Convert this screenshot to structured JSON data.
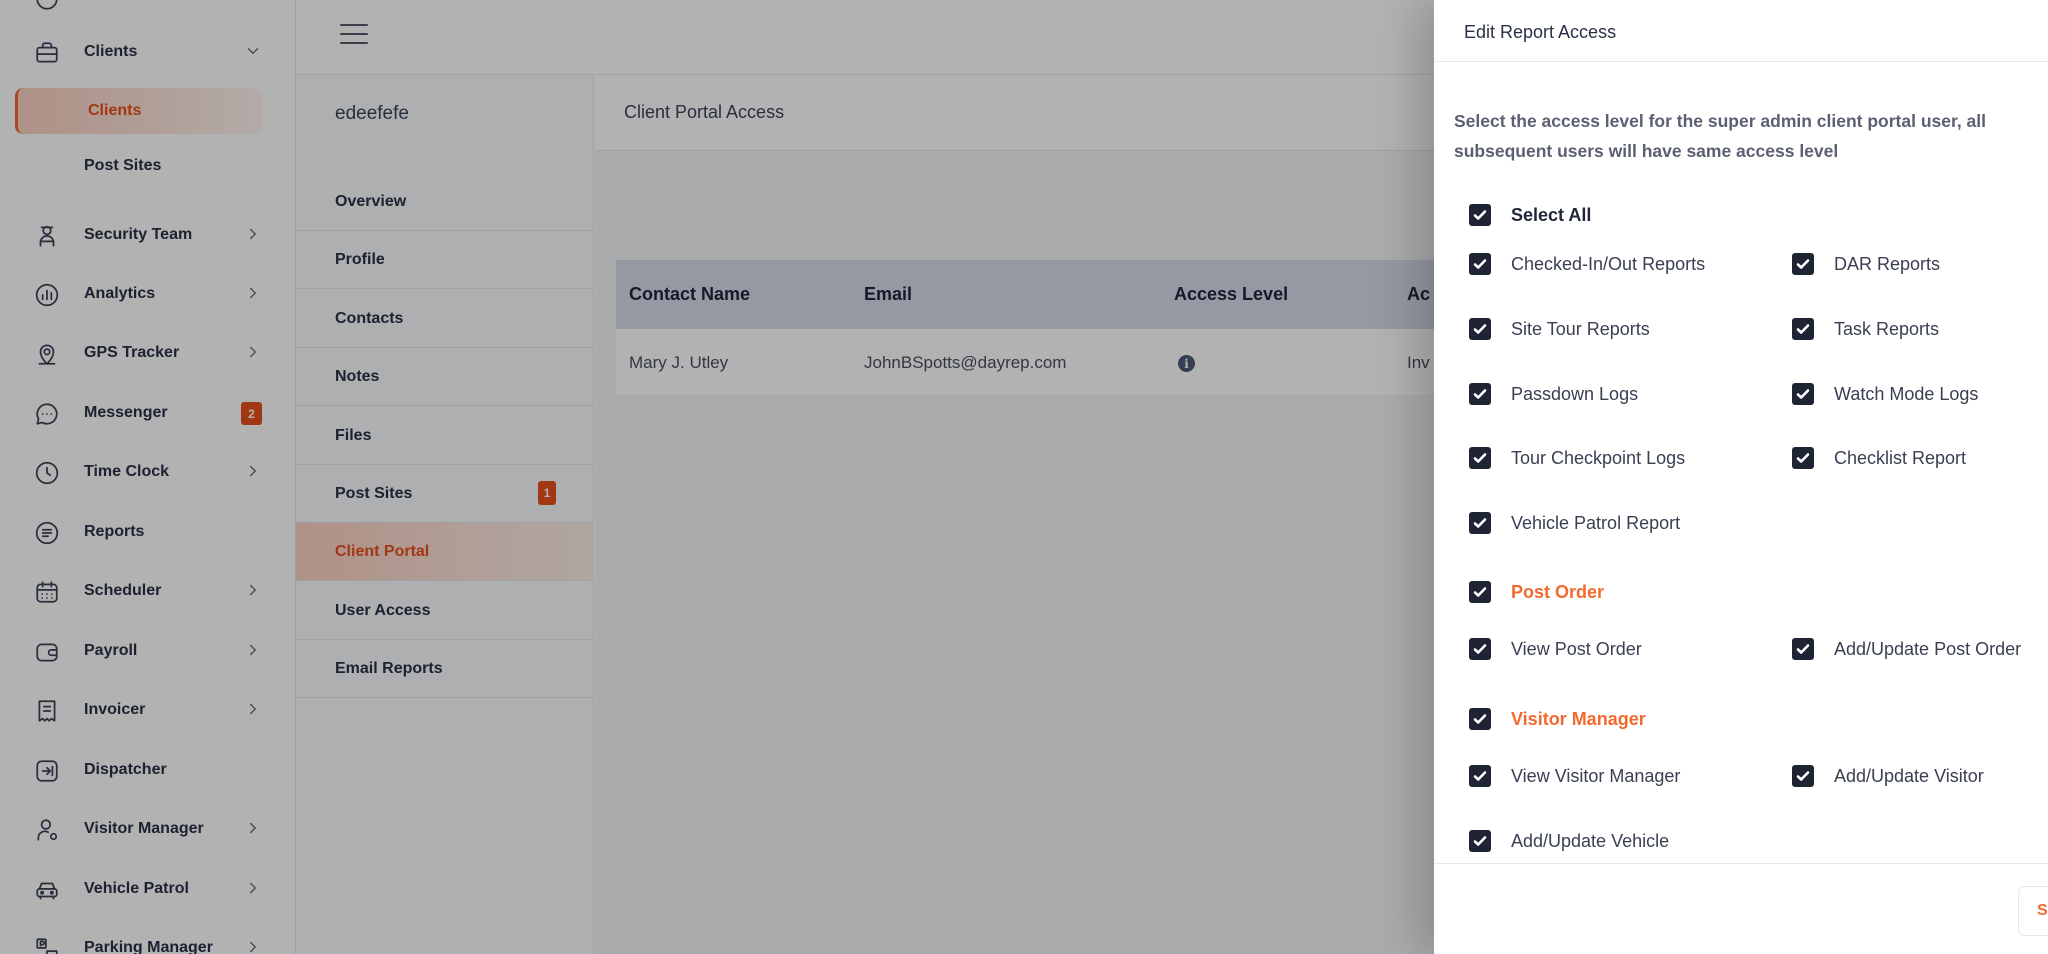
{
  "sidebar": {
    "items": [
      {
        "label": "Clients",
        "icon": "briefcase-icon",
        "chevron": "down"
      },
      {
        "label": "Security Team",
        "icon": "guard-icon",
        "chevron": "right"
      },
      {
        "label": "Analytics",
        "icon": "analytics-icon",
        "chevron": "right"
      },
      {
        "label": "GPS Tracker",
        "icon": "location-pin-icon",
        "chevron": "right"
      },
      {
        "label": "Messenger",
        "icon": "chat-icon",
        "badge": "2"
      },
      {
        "label": "Time Clock",
        "icon": "clock-icon",
        "chevron": "right"
      },
      {
        "label": "Reports",
        "icon": "report-icon"
      },
      {
        "label": "Scheduler",
        "icon": "calendar-icon",
        "chevron": "right"
      },
      {
        "label": "Payroll",
        "icon": "wallet-icon",
        "chevron": "right"
      },
      {
        "label": "Invoicer",
        "icon": "invoice-icon",
        "chevron": "right"
      },
      {
        "label": "Dispatcher",
        "icon": "dispatch-icon"
      },
      {
        "label": "Visitor Manager",
        "icon": "visitor-icon",
        "chevron": "right"
      },
      {
        "label": "Vehicle Patrol",
        "icon": "car-icon",
        "chevron": "right"
      },
      {
        "label": "Parking Manager",
        "icon": "parking-icon",
        "chevron": "right"
      }
    ],
    "sub_items": {
      "clients_active": "Clients",
      "post_sites": "Post Sites"
    }
  },
  "subnav": {
    "client_name": "edeefefe",
    "items": [
      {
        "label": "Overview"
      },
      {
        "label": "Profile"
      },
      {
        "label": "Contacts"
      },
      {
        "label": "Notes"
      },
      {
        "label": "Files"
      },
      {
        "label": "Post Sites",
        "badge": "1"
      },
      {
        "label": "Client Portal",
        "active": true
      },
      {
        "label": "User Access"
      },
      {
        "label": "Email Reports"
      }
    ]
  },
  "main": {
    "section_title": "Client Portal Access",
    "table": {
      "headers": [
        "Contact Name",
        "Email",
        "Access Level",
        "Ac"
      ],
      "rows": [
        {
          "name": "Mary J. Utley",
          "email": "JohnBSpotts@dayrep.com",
          "access_icon": "info-icon",
          "status": "Inv"
        }
      ]
    }
  },
  "drawer": {
    "title": "Edit Report Access",
    "description": "Select the access level for the super admin client portal user, all subsequent users will have same access level",
    "select_all": "Select All",
    "reports": [
      "Checked-In/Out Reports",
      "DAR Reports",
      "Site Tour Reports",
      "Task Reports",
      "Passdown Logs",
      "Watch Mode Logs",
      "Tour Checkpoint Logs",
      "Checklist Report",
      "Vehicle Patrol Report"
    ],
    "post_order": {
      "title": "Post Order",
      "items": [
        "View Post Order",
        "Add/Update Post Order"
      ]
    },
    "visitor_manager": {
      "title": "Visitor Manager",
      "items": [
        "View Visitor Manager",
        "Add/Update Visitor",
        "Add/Update Vehicle"
      ]
    },
    "save_label": "S"
  },
  "colors": {
    "accent": "#f26a2e",
    "badge": "#e8501e",
    "checkbox": "#1e2433",
    "table_header": "#d4dceb"
  }
}
